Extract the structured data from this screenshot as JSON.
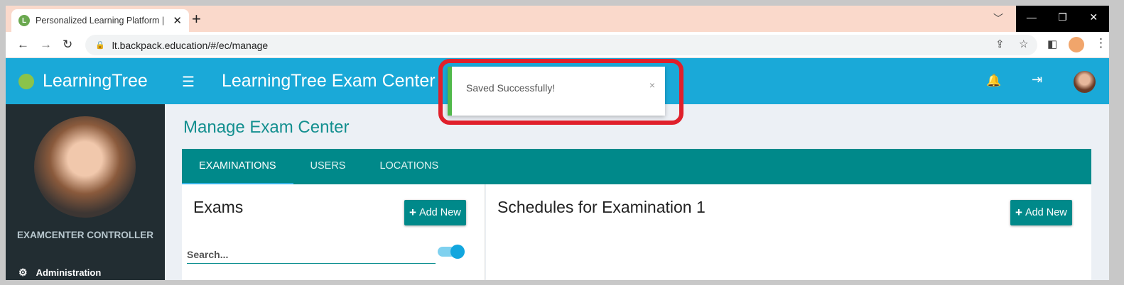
{
  "browser": {
    "tab_title": "Personalized Learning Platform |",
    "tab_close": "✕",
    "new_tab": "+",
    "url": "lt.backpack.education/#/ec/manage",
    "window_controls": [
      "—",
      "❐",
      "✕"
    ]
  },
  "header": {
    "brand": "LearningTree",
    "title": "LearningTree Exam Center"
  },
  "sidebar": {
    "role": "EXAMCENTER CONTROLLER",
    "items": [
      {
        "label": "Administration"
      }
    ]
  },
  "main": {
    "page_title": "Manage Exam Center",
    "tabs": [
      {
        "label": "EXAMINATIONS"
      },
      {
        "label": "USERS"
      },
      {
        "label": "LOCATIONS"
      }
    ],
    "exams": {
      "title": "Exams",
      "add_label": "Add New",
      "search_placeholder": "Search..."
    },
    "schedules": {
      "title": "Schedules for Examination 1",
      "add_label": "Add New"
    }
  },
  "toast": {
    "message": "Saved Successfully!",
    "close": "×"
  },
  "colors": {
    "header": "#1aa9d8",
    "teal": "#00898a",
    "sidebar": "#222d32",
    "highlight": "#e0202b",
    "success": "#51b94b"
  }
}
